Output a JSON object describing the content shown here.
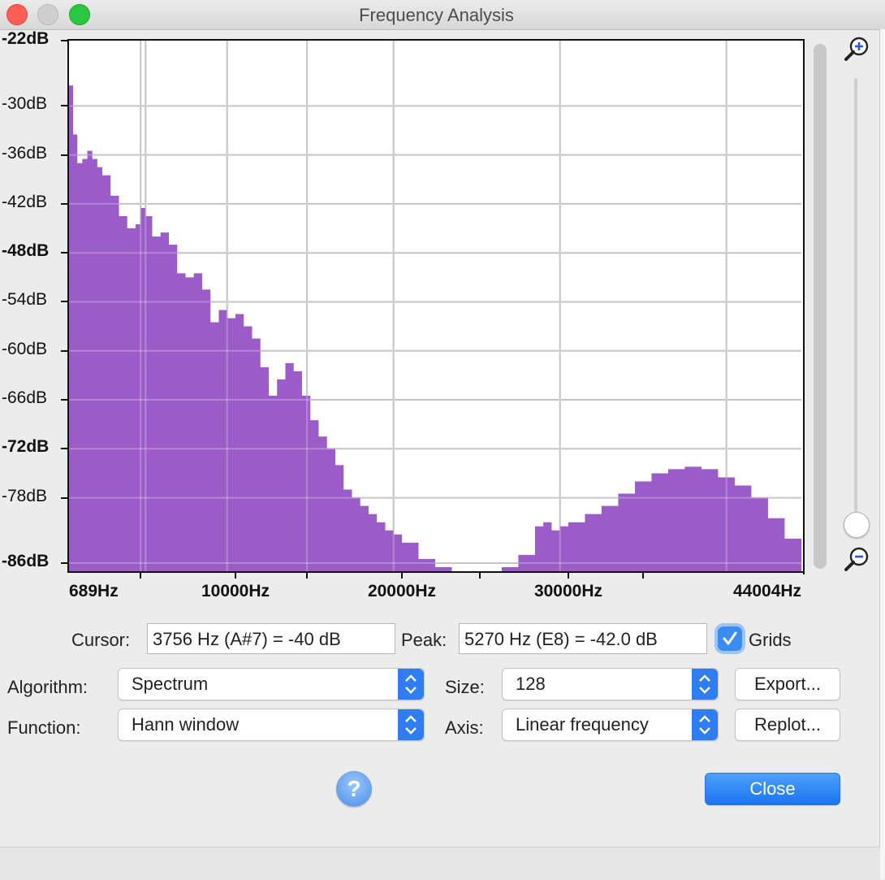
{
  "window": {
    "title": "Frequency Analysis"
  },
  "chart_data": {
    "type": "area",
    "xlabel": "",
    "ylabel": "",
    "xlim": [
      0,
      44004
    ],
    "ylim": [
      -87,
      -22
    ],
    "y_ticks": [
      {
        "value": -22,
        "label": "-22dB",
        "bold": true
      },
      {
        "value": -30,
        "label": "-30dB",
        "bold": false
      },
      {
        "value": -36,
        "label": "-36dB",
        "bold": false
      },
      {
        "value": -42,
        "label": "-42dB",
        "bold": false
      },
      {
        "value": -48,
        "label": "-48dB",
        "bold": true
      },
      {
        "value": -54,
        "label": "-54dB",
        "bold": false
      },
      {
        "value": -60,
        "label": "-60dB",
        "bold": false
      },
      {
        "value": -66,
        "label": "-66dB",
        "bold": false
      },
      {
        "value": -72,
        "label": "-72dB",
        "bold": true
      },
      {
        "value": -78,
        "label": "-78dB",
        "bold": false
      },
      {
        "value": -86,
        "label": "-86dB",
        "bold": true
      }
    ],
    "x_tick_labels": [
      {
        "value": 689,
        "label": "689Hz"
      },
      {
        "value": 10000,
        "label": "10000Hz"
      },
      {
        "value": 20000,
        "label": "20000Hz"
      },
      {
        "value": 30000,
        "label": "30000Hz"
      },
      {
        "value": 44004,
        "label": "44004Hz"
      }
    ],
    "x_gridlines": [
      4300,
      4600,
      9500,
      14300,
      19500,
      29500,
      39500
    ],
    "grid": true,
    "color": "#9b5cc7",
    "x": [
      0,
      250,
      500,
      800,
      1100,
      1400,
      1700,
      2000,
      2500,
      3000,
      3500,
      4000,
      4300,
      4600,
      5000,
      5500,
      6000,
      6500,
      7000,
      7500,
      8000,
      8500,
      9000,
      9500,
      10000,
      10500,
      11000,
      11500,
      12000,
      12500,
      13000,
      13500,
      14000,
      14500,
      15000,
      15500,
      16000,
      16500,
      17000,
      17500,
      18000,
      18500,
      19000,
      19500,
      20000,
      21000,
      22000,
      23000,
      24000,
      25000,
      26000,
      27000,
      28000,
      28500,
      29000,
      29500,
      30000,
      31000,
      32000,
      33000,
      34000,
      35000,
      36000,
      37000,
      38000,
      39000,
      40000,
      41000,
      42000,
      43000,
      44004
    ],
    "values": [
      -27.5,
      -33.5,
      -37.0,
      -36.5,
      -35.5,
      -36.5,
      -37.5,
      -38.5,
      -41.0,
      -43.5,
      -45.0,
      -44.5,
      -42.5,
      -43.5,
      -46.0,
      -45.5,
      -47.0,
      -50.5,
      -51.0,
      -50.5,
      -52.5,
      -56.5,
      -55.0,
      -56.0,
      -55.5,
      -57.0,
      -58.5,
      -62.0,
      -65.5,
      -63.5,
      -61.5,
      -62.5,
      -65.5,
      -68.5,
      -70.5,
      -72.0,
      -74.0,
      -77.0,
      -78.0,
      -79.0,
      -80.0,
      -81.0,
      -82.0,
      -82.5,
      -83.5,
      -85.5,
      -86.5,
      -87.0,
      -87.0,
      -87.0,
      -86.5,
      -85.0,
      -81.5,
      -81.0,
      -82.0,
      -81.5,
      -81.0,
      -80.0,
      -79.0,
      -77.5,
      -76.0,
      -75.0,
      -74.5,
      -74.2,
      -74.5,
      -75.5,
      -76.5,
      -78.0,
      -80.5,
      -83.0,
      -84.5
    ]
  },
  "cursor": {
    "label": "Cursor:",
    "value": "3756 Hz (A#7) = -40 dB"
  },
  "peak": {
    "label": "Peak:",
    "value": "5270 Hz (E8) = -42.0 dB"
  },
  "grids": {
    "label": "Grids",
    "checked": true
  },
  "algorithm": {
    "label": "Algorithm:",
    "value": "Spectrum"
  },
  "function": {
    "label": "Function:",
    "value": "Hann window"
  },
  "size": {
    "label": "Size:",
    "value": "128"
  },
  "axis": {
    "label": "Axis:",
    "value": "Linear frequency"
  },
  "buttons": {
    "export": "Export...",
    "replot": "Replot...",
    "close": "Close",
    "help": "?"
  }
}
